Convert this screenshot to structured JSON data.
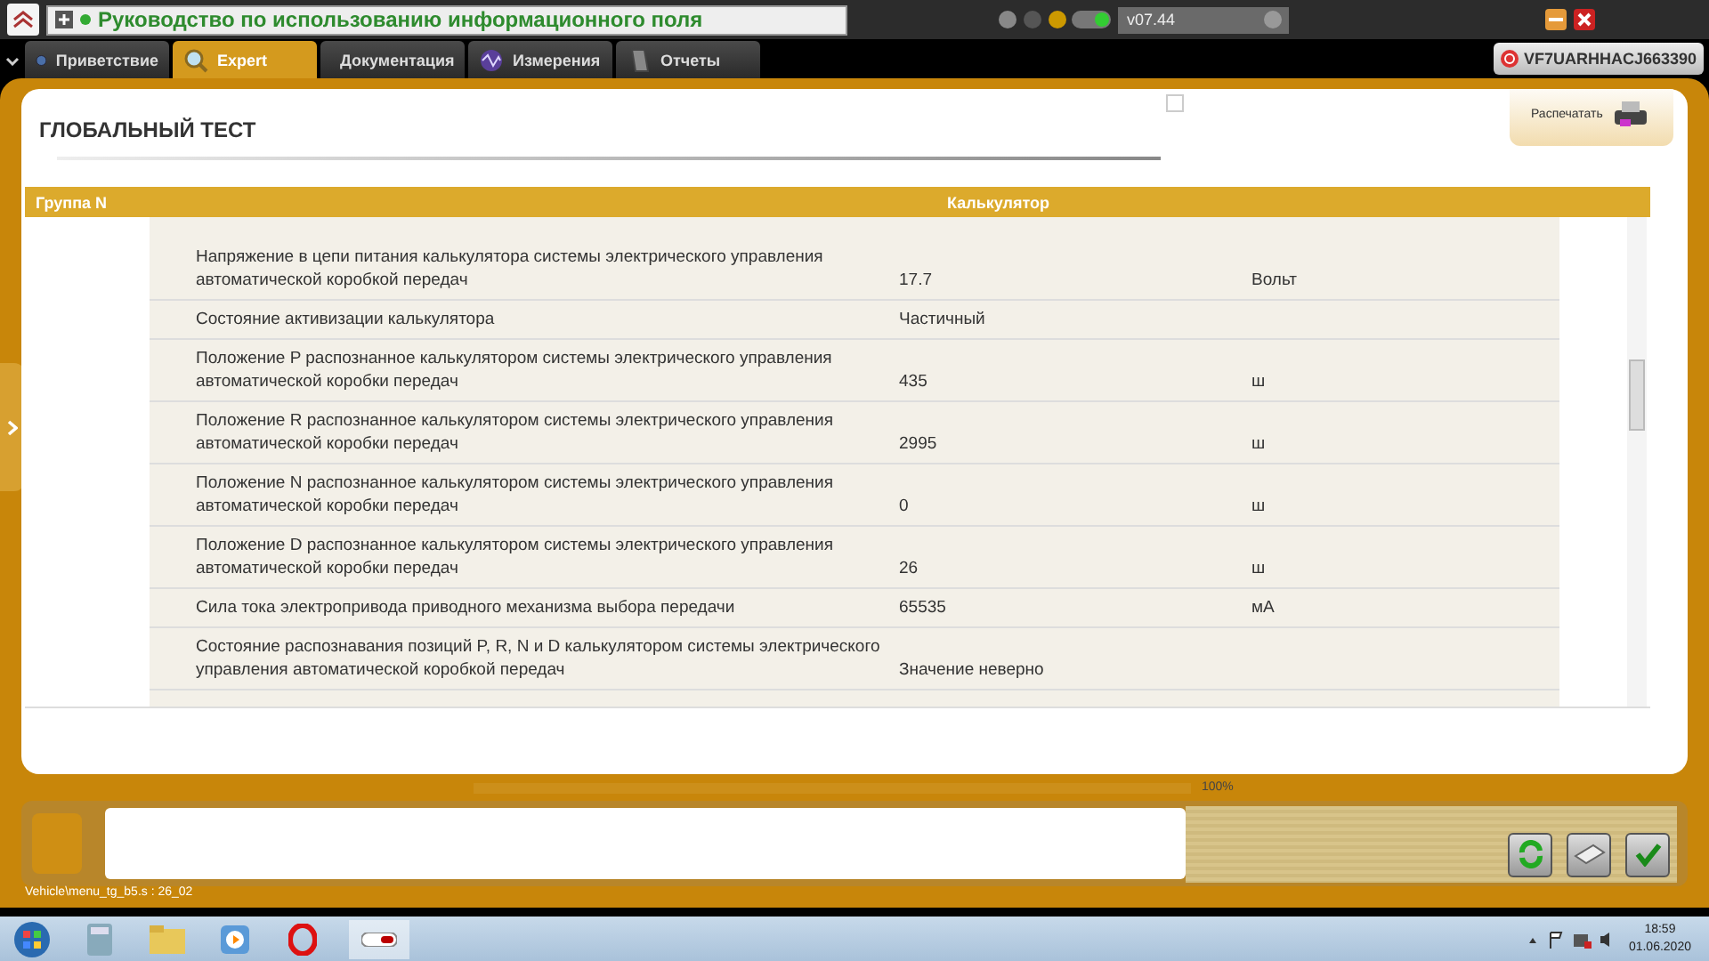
{
  "app_bar": {
    "title": "Руководство по использованию информационного поля",
    "version": "v07.44"
  },
  "tabs": [
    {
      "label": "Приветствие",
      "selected": false
    },
    {
      "label": "Expert",
      "selected": true
    },
    {
      "label": "Документация",
      "selected": false
    },
    {
      "label": "Измерения",
      "selected": false
    },
    {
      "label": "Отчеты",
      "selected": false
    }
  ],
  "vin": "VF7UARHHACJ663390",
  "page": {
    "title": "ГЛОБАЛЬНЫЙ ТЕСТ",
    "print_button": "Распечатать"
  },
  "table": {
    "columns": [
      "Группа N",
      "Калькулятор"
    ],
    "rows": [
      {
        "parameter": "Напряжение в цепи питания калькулятора системы электрического управления автоматической коробкой передач",
        "value": "17.7",
        "unit": "Вольт"
      },
      {
        "parameter": "Состояние активизации калькулятора",
        "value": "Частичный"
      },
      {
        "parameter": "Положение P распознанное калькулятором системы электрического управления автоматической коробки передач",
        "value": "435",
        "unit": "ш"
      },
      {
        "parameter": "Положение R распознанное калькулятором системы электрического управления автоматической коробки передач",
        "value": "2995",
        "unit": "ш"
      },
      {
        "parameter": "Положение N распознанное калькулятором системы электрического управления автоматической коробки передач",
        "value": "0",
        "unit": "ш"
      },
      {
        "parameter": "Положение D распознанное калькулятором системы электрического управления автоматической коробки передач",
        "value": "26",
        "unit": "ш"
      },
      {
        "parameter": "Сила тока электропривода приводного механизма выбора передачи",
        "value": "65535",
        "unit": "мА"
      },
      {
        "parameter": "Состояние распознавания позиций P, R, N и D калькулятором системы электрического управления автоматической коробкой передач",
        "value": "Значение неверно"
      }
    ]
  },
  "progress": {
    "level": 1,
    "reading": "100%"
  },
  "status_path": "Vehicle\\menu_tg_b5.s : 26_02",
  "taskbar": {
    "time": "18:59",
    "date": "01.06.2020"
  }
}
